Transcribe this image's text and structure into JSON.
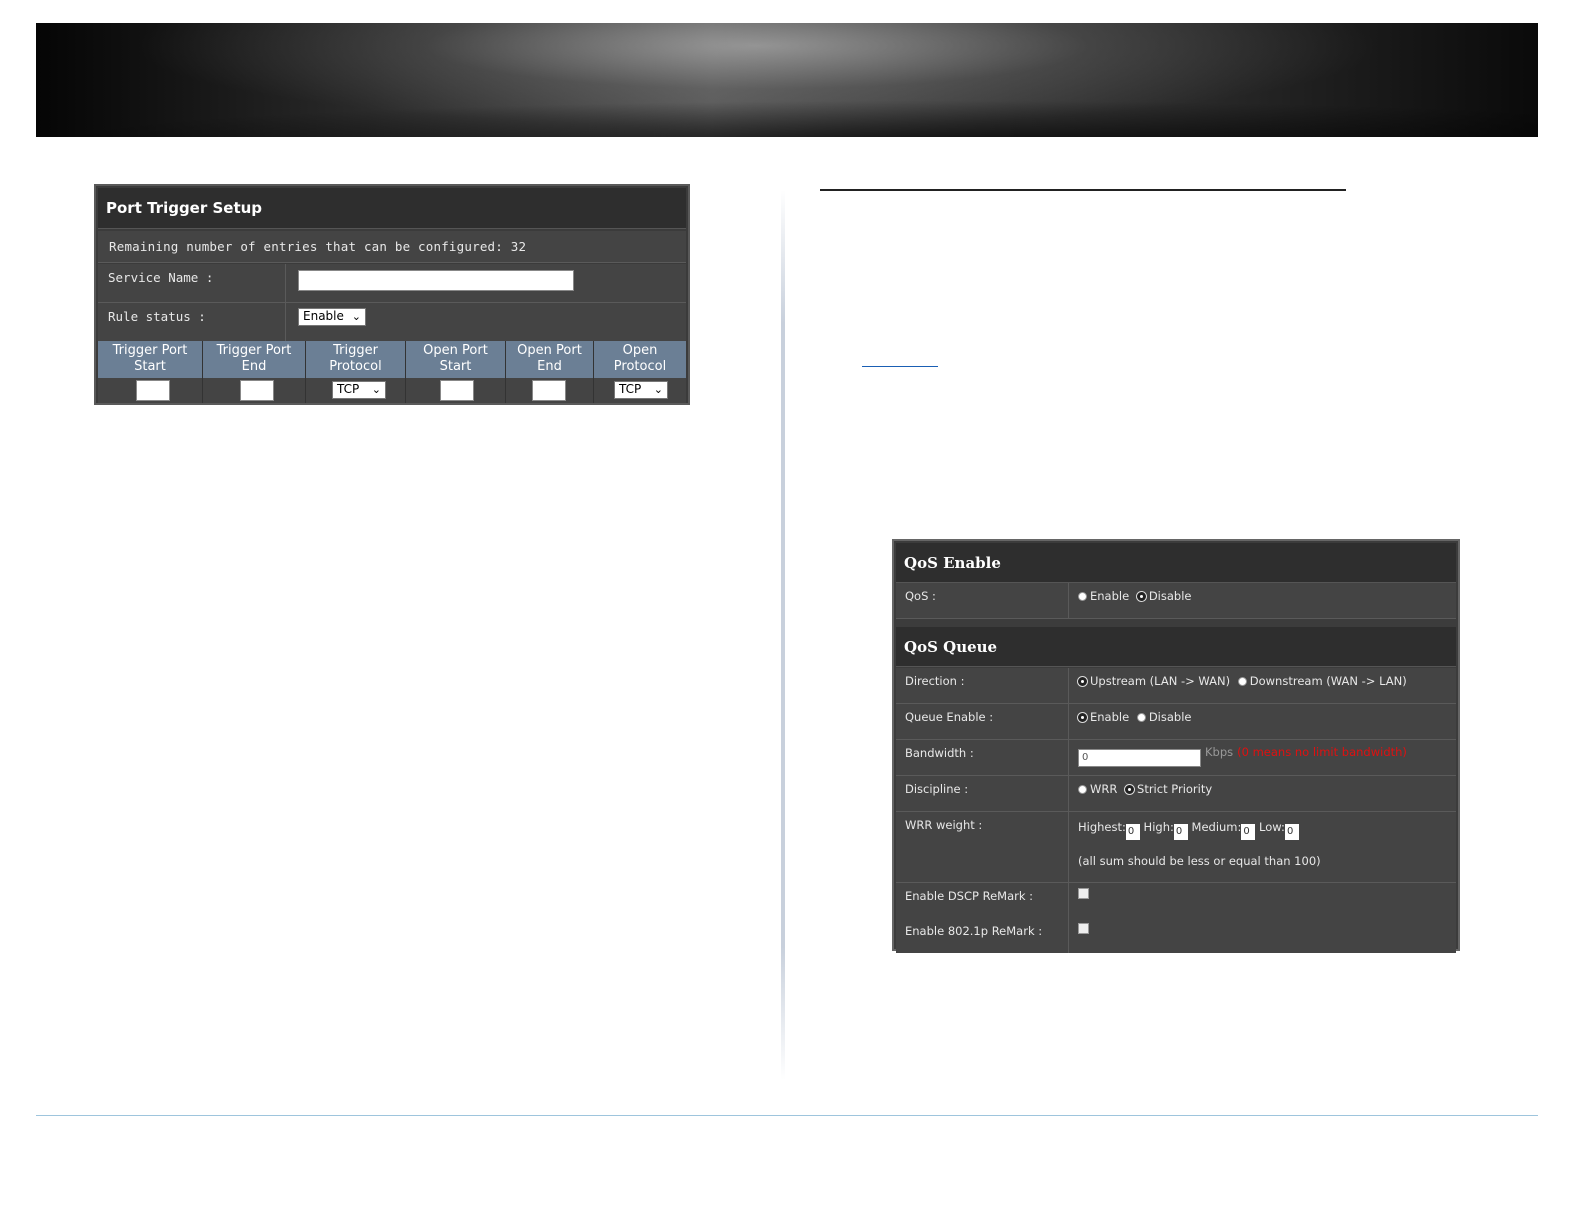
{
  "port_trigger": {
    "title": "Port Trigger Setup",
    "remaining": "Remaining number of entries that can be configured: 32",
    "service_name_label": "Service Name :",
    "service_name_value": "",
    "rule_status_label": "Rule status :",
    "rule_status_value": "Enable",
    "columns": [
      [
        "Trigger Port",
        "Start"
      ],
      [
        "Trigger Port",
        "End"
      ],
      [
        "Trigger",
        "Protocol"
      ],
      [
        "Open Port",
        "Start"
      ],
      [
        "Open Port",
        "End"
      ],
      [
        "Open",
        "Protocol"
      ]
    ],
    "trigger_protocol": "TCP",
    "open_protocol": "TCP"
  },
  "qos": {
    "enable_header": "QoS Enable",
    "qos_label": "QoS :",
    "qos_options": [
      "Enable",
      "Disable"
    ],
    "qos_selected": "Disable",
    "queue_header": "QoS Queue",
    "direction_label": "Direction :",
    "direction_options": [
      "Upstream (LAN -> WAN)",
      "Downstream (WAN -> LAN)"
    ],
    "direction_selected": "Upstream (LAN -> WAN)",
    "queue_enable_label": "Queue Enable :",
    "queue_enable_options": [
      "Enable",
      "Disable"
    ],
    "queue_enable_selected": "Enable",
    "bandwidth_label": "Bandwidth :",
    "bandwidth_value": "0",
    "bandwidth_unit": "Kbps",
    "bandwidth_note": "(0 means no limit bandwidth)",
    "discipline_label": "Discipline :",
    "discipline_options": [
      "WRR",
      "Strict Priority"
    ],
    "discipline_selected": "Strict Priority",
    "wrr_label": "WRR weight :",
    "wrr_fields": [
      {
        "label": "Highest:",
        "value": "0"
      },
      {
        "label": "High:",
        "value": "0"
      },
      {
        "label": "Medium:",
        "value": "0"
      },
      {
        "label": "Low:",
        "value": "0"
      }
    ],
    "wrr_note": "(all sum should be less or equal than 100)",
    "dscp_label": "Enable DSCP ReMark :",
    "dscp_checked": false,
    "dot1p_label": "Enable 802.1p ReMark :",
    "dot1p_checked": false
  }
}
